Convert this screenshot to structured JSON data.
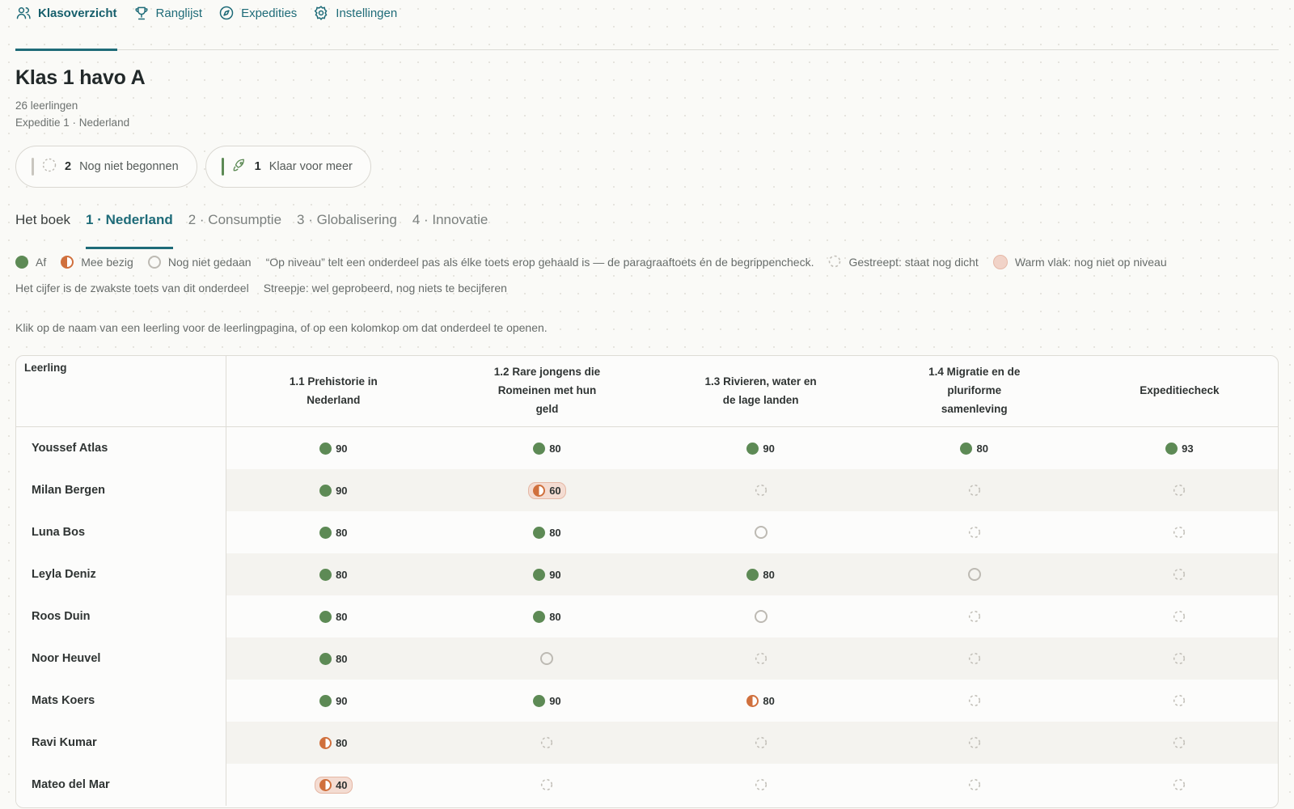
{
  "nav": {
    "items": [
      {
        "label": "Klasoverzicht",
        "icon": "users-icon",
        "active": true
      },
      {
        "label": "Ranglijst",
        "icon": "trophy-icon",
        "active": false
      },
      {
        "label": "Expedities",
        "icon": "compass-icon",
        "active": false
      },
      {
        "label": "Instellingen",
        "icon": "gear-icon",
        "active": false
      }
    ]
  },
  "class": {
    "title": "Klas 1 havo A",
    "students": "26 leerlingen",
    "expedition": "Expeditie 1 · Nederland"
  },
  "pills": [
    {
      "count": "2",
      "label": "Nog niet begonnen",
      "bar_color": "#c9c6bf",
      "icon": "dashed-circle-icon"
    },
    {
      "count": "1",
      "label": "Klaar voor meer",
      "bar_color": "#5d8a55",
      "icon": "rocket-icon"
    }
  ],
  "tabs": [
    {
      "label": "Het boek",
      "active": false
    },
    {
      "label": "1 · Nederland",
      "active": true
    },
    {
      "label": "2 · Consumptie",
      "active": false
    },
    {
      "label": "3 · Globalisering",
      "active": false
    },
    {
      "label": "4 · Innovatie",
      "active": false
    }
  ],
  "legend": {
    "done": "Af",
    "busy": "Mee bezig",
    "todo": "Nog niet gedaan",
    "note": "“Op niveau” telt een onderdeel pas als élke toets erop gehaald is — de paragraaftoets én de begrippencheck.",
    "locked": "Gestreept: staat nog dicht",
    "warm": "Warm vlak: nog niet op niveau",
    "weakest": "Het cijfer is de zwakste toets van dit onderdeel",
    "dash": "Streepje: wel geprobeerd, nog niets te becijferen"
  },
  "hint": "Klik op de naam van een leerling voor de leerlingpagina, of op een kolomkop om dat onderdeel te openen.",
  "table": {
    "name_header": "Leerling",
    "columns": [
      "1.1 Prehistorie in Nederland",
      "1.2 Rare jongens die Romeinen met hun geld",
      "1.3 Rivieren, water en de lage landen",
      "1.4 Migratie en de pluriforme samenleving",
      "Expeditiecheck"
    ],
    "rows": [
      {
        "name": "Youssef Atlas",
        "cells": [
          {
            "s": "done",
            "v": "90"
          },
          {
            "s": "done",
            "v": "80"
          },
          {
            "s": "done",
            "v": "90"
          },
          {
            "s": "done",
            "v": "80"
          },
          {
            "s": "done",
            "v": "93"
          }
        ]
      },
      {
        "name": "Milan Bergen",
        "cells": [
          {
            "s": "done",
            "v": "90"
          },
          {
            "s": "busy",
            "v": "60",
            "warm": true
          },
          {
            "s": "locked"
          },
          {
            "s": "locked"
          },
          {
            "s": "locked"
          }
        ]
      },
      {
        "name": "Luna Bos",
        "cells": [
          {
            "s": "done",
            "v": "80"
          },
          {
            "s": "done",
            "v": "80"
          },
          {
            "s": "todo"
          },
          {
            "s": "locked"
          },
          {
            "s": "locked"
          }
        ]
      },
      {
        "name": "Leyla Deniz",
        "cells": [
          {
            "s": "done",
            "v": "80"
          },
          {
            "s": "done",
            "v": "90"
          },
          {
            "s": "done",
            "v": "80"
          },
          {
            "s": "todo"
          },
          {
            "s": "locked"
          }
        ]
      },
      {
        "name": "Roos Duin",
        "cells": [
          {
            "s": "done",
            "v": "80"
          },
          {
            "s": "done",
            "v": "80"
          },
          {
            "s": "todo"
          },
          {
            "s": "locked"
          },
          {
            "s": "locked"
          }
        ]
      },
      {
        "name": "Noor Heuvel",
        "cells": [
          {
            "s": "done",
            "v": "80"
          },
          {
            "s": "todo"
          },
          {
            "s": "locked"
          },
          {
            "s": "locked"
          },
          {
            "s": "locked"
          }
        ]
      },
      {
        "name": "Mats Koers",
        "cells": [
          {
            "s": "done",
            "v": "90"
          },
          {
            "s": "done",
            "v": "90"
          },
          {
            "s": "busy",
            "v": "80"
          },
          {
            "s": "locked"
          },
          {
            "s": "locked"
          }
        ]
      },
      {
        "name": "Ravi Kumar",
        "cells": [
          {
            "s": "busy",
            "v": "80"
          },
          {
            "s": "locked"
          },
          {
            "s": "locked"
          },
          {
            "s": "locked"
          },
          {
            "s": "locked"
          }
        ]
      },
      {
        "name": "Mateo del Mar",
        "cells": [
          {
            "s": "busy",
            "v": "40",
            "warm": true
          },
          {
            "s": "locked"
          },
          {
            "s": "locked"
          },
          {
            "s": "locked"
          },
          {
            "s": "locked"
          }
        ]
      }
    ]
  }
}
